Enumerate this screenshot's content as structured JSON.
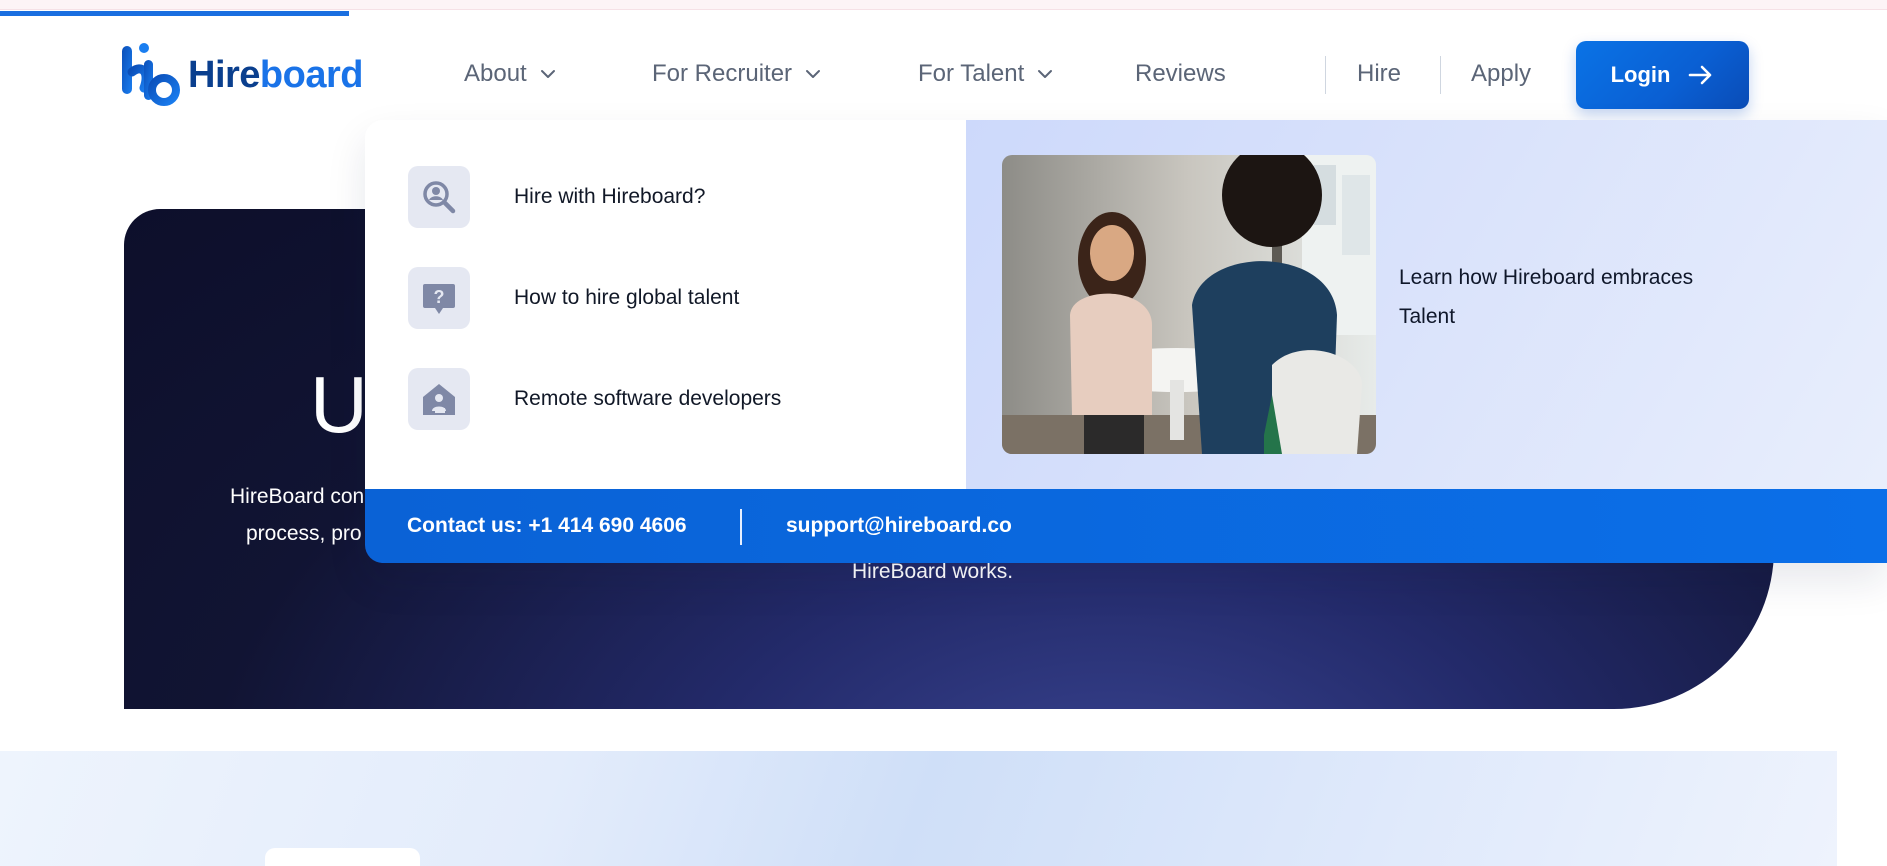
{
  "brand": {
    "name_part1": "Hire",
    "name_part2": "board",
    "logo_icon": "hb-monogram-icon",
    "colors": {
      "primary": "#1a73e8",
      "dark": "#0a3f8e"
    }
  },
  "nav": {
    "items": [
      {
        "label": "About",
        "has_dropdown": true
      },
      {
        "label": "For Recruiter",
        "has_dropdown": true
      },
      {
        "label": "For Talent",
        "has_dropdown": true
      },
      {
        "label": "Reviews",
        "has_dropdown": false
      }
    ],
    "hire_label": "Hire",
    "apply_label": "Apply",
    "login_label": "Login",
    "login_icon": "arrow-right-icon"
  },
  "hero": {
    "title_visible": "U",
    "line1_visible": "HireBoard con",
    "line2_visible": "process, pro",
    "line3_visible": "HireBoard works."
  },
  "dropdown": {
    "items": [
      {
        "label": "Hire with Hireboard?",
        "icon": "search-user-icon"
      },
      {
        "label": "How to hire global talent",
        "icon": "question-chat-icon"
      },
      {
        "label": "Remote software developers",
        "icon": "home-worker-icon"
      }
    ],
    "promo_text": "Learn how Hireboard embraces Talent",
    "photo_icon": "interview-photo",
    "contact_phone": "Contact us: +1 414 690 4606",
    "contact_email": "support@hireboard.co"
  }
}
